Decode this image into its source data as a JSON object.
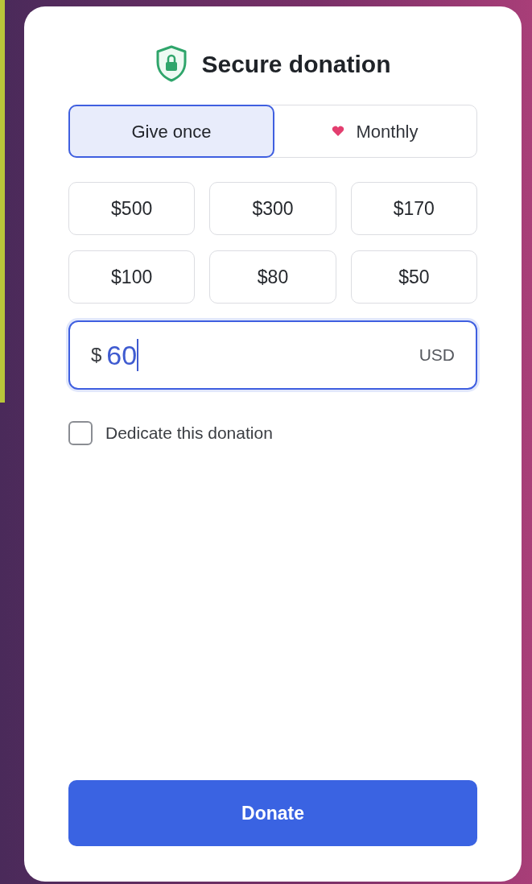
{
  "title": "Secure donation",
  "frequency": [
    {
      "label": "Give once",
      "selected": true,
      "kind": "once"
    },
    {
      "label": "Monthly",
      "selected": false,
      "kind": "recurring"
    }
  ],
  "amounts": [
    {
      "label": "$500",
      "selected": false
    },
    {
      "label": "$300",
      "selected": false
    },
    {
      "label": "$170",
      "selected": false
    },
    {
      "label": "$100",
      "selected": false
    },
    {
      "label": "$80",
      "selected": false
    },
    {
      "label": "$50",
      "selected": false
    }
  ],
  "amount_field": {
    "prefix": "$",
    "value": "60",
    "currency": "USD",
    "focused": true
  },
  "dedicate": {
    "label": "Dedicate this donation",
    "checked": false
  },
  "submit": {
    "label": "Donate"
  }
}
